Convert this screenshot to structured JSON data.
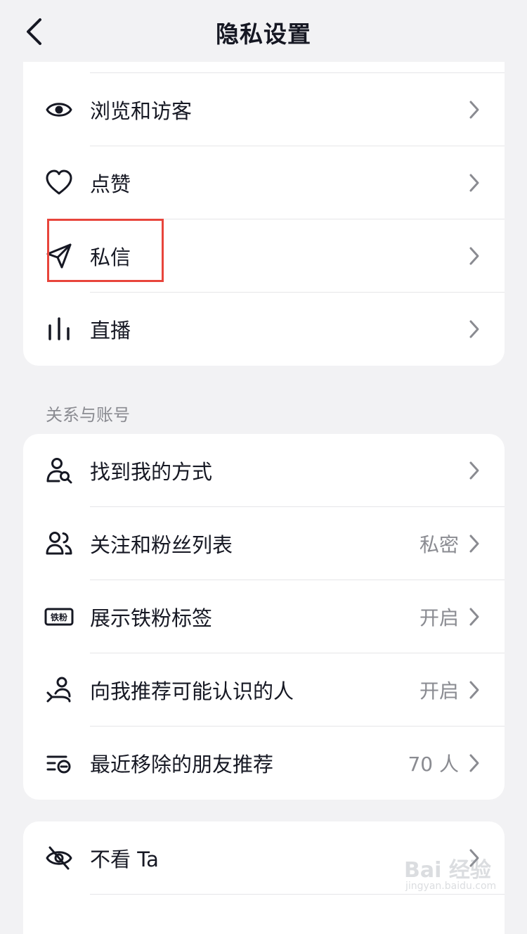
{
  "header": {
    "title": "隐私设置",
    "back_icon": "chevron-left-icon"
  },
  "section1": {
    "items": [
      {
        "label": "浏览和访客",
        "icon": "eye-icon"
      },
      {
        "label": "点赞",
        "icon": "heart-icon"
      },
      {
        "label": "私信",
        "icon": "paper-plane-icon"
      },
      {
        "label": "直播",
        "icon": "bar-chart-icon"
      }
    ]
  },
  "section2": {
    "title": "关系与账号",
    "items": [
      {
        "label": "找到我的方式",
        "value": "",
        "icon": "user-search-icon"
      },
      {
        "label": "关注和粉丝列表",
        "value": "私密",
        "icon": "users-icon"
      },
      {
        "label": "展示铁粉标签",
        "value": "开启",
        "icon": "fan-badge-icon",
        "badge_text": "铁粉"
      },
      {
        "label": "向我推荐可能认识的人",
        "value": "开启",
        "icon": "user-recommend-icon"
      },
      {
        "label": "最近移除的朋友推荐",
        "value": "70 人",
        "icon": "removed-list-icon"
      }
    ]
  },
  "section3": {
    "items": [
      {
        "label": "不看 Ta",
        "icon": "eye-off-icon"
      }
    ]
  },
  "watermark": {
    "main": "Bai 经验",
    "sub": "jingyan.baidu.com"
  },
  "colors": {
    "highlight": "#e8453c",
    "background": "#f2f2f4",
    "text": "#161823",
    "secondary": "#8a8b91"
  }
}
